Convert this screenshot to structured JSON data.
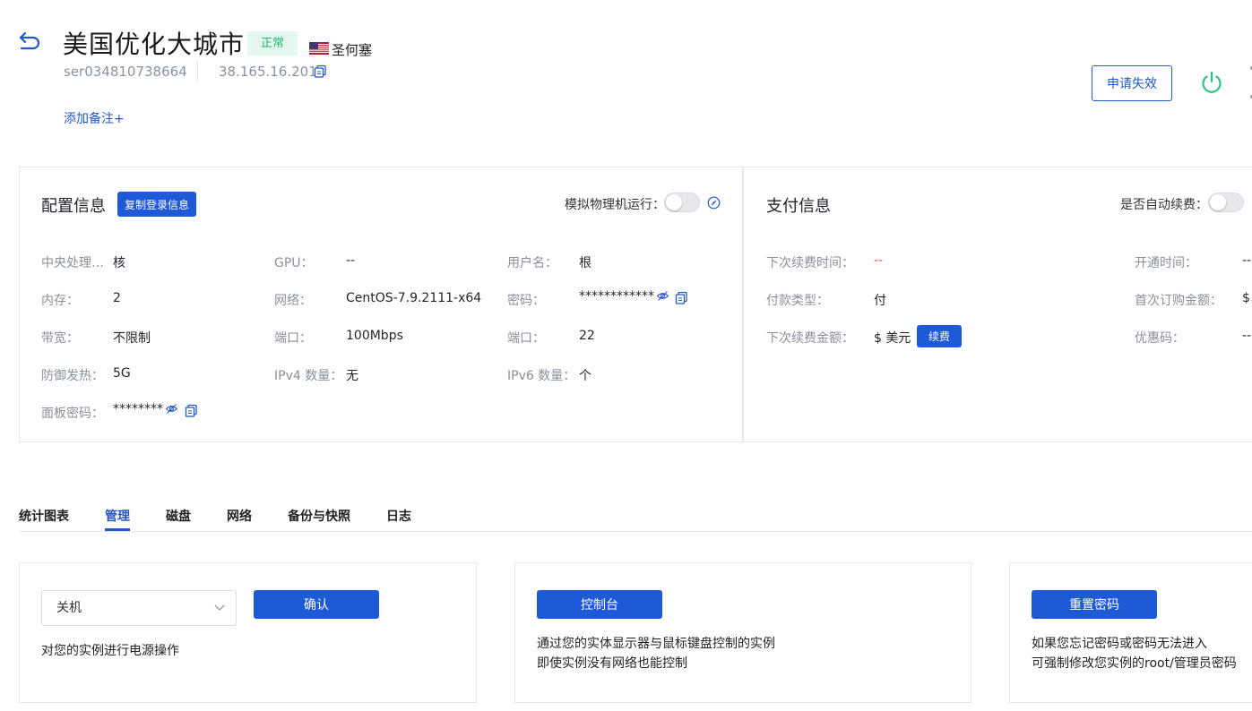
{
  "header": {
    "title": "美国优化大城市",
    "status": "正常",
    "location": "圣何塞",
    "server_id": "ser034810738664",
    "ip": "38.165.16.201",
    "add_note": "添加备注+",
    "invalidate_button": "申请失效"
  },
  "config": {
    "title": "配置信息",
    "copy_login_button": "复制登录信息",
    "simulate_label": "模拟物理机运行：",
    "fields": [
      {
        "label": "中央处理…",
        "value": "核"
      },
      {
        "label": "GPU：",
        "value": "--"
      },
      {
        "label": "用户名：",
        "value": "根"
      },
      {
        "label": "内存：",
        "value": "2"
      },
      {
        "label": "网络：",
        "value": "CentOS-7.9.2111-x64"
      },
      {
        "label": "密码：",
        "value": "************"
      },
      {
        "label": "带宽：",
        "value": "不限制"
      },
      {
        "label": "端口：",
        "value": "100Mbps"
      },
      {
        "label": "端口：",
        "value": "22"
      },
      {
        "label": "防御发热：",
        "value": "5G"
      },
      {
        "label": "IPv4 数量：",
        "value": "无"
      },
      {
        "label": "IPv6 数量：",
        "value": "个"
      },
      {
        "label": "面板密码：",
        "value": "********"
      }
    ]
  },
  "payment": {
    "title": "支付信息",
    "auto_renew_label": "是否自动续费：",
    "fields": [
      {
        "label": "下次续费时间：",
        "value": "--"
      },
      {
        "label": "开通时间：",
        "value": "--"
      },
      {
        "label": "付款类型：",
        "value": "付"
      },
      {
        "label": "首次订购金额：",
        "value": "$"
      },
      {
        "label": "下次续费金额：",
        "value": "$ 美元"
      },
      {
        "label": "优惠码：",
        "value": "--"
      }
    ],
    "renew_button": "续费",
    "warn_color": "#e5484d"
  },
  "tabs": [
    "统计图表",
    "管理",
    "磁盘",
    "网络",
    "备份与快照",
    "日志"
  ],
  "active_tab": "管理",
  "panels": {
    "power": {
      "select_value": "关机",
      "confirm_button": "确认",
      "desc": "对您的实例进行电源操作"
    },
    "console": {
      "button": "控制台",
      "desc_line1": "通过您的实体显示器与鼠标键盘控制的实例",
      "desc_line2": "即使实例没有网络也能控制"
    },
    "reset": {
      "button": "重置密码",
      "desc_line1": "如果您忘记密码或密码无法进入",
      "desc_line2": "可强制修改您实例的root/管理员密码"
    }
  },
  "colors": {
    "accent": "#2458c6",
    "primary_button": "#1e5ad8",
    "status_green": "#2bb673",
    "power_green": "#2ec27e"
  },
  "icons": {
    "back": "back-arrow-icon",
    "copy": "copy-icon",
    "eye": "eye-hidden-icon",
    "help": "help-icon",
    "power": "power-icon",
    "chevron": "chevron-down-icon",
    "flag": "us-flag-icon"
  }
}
